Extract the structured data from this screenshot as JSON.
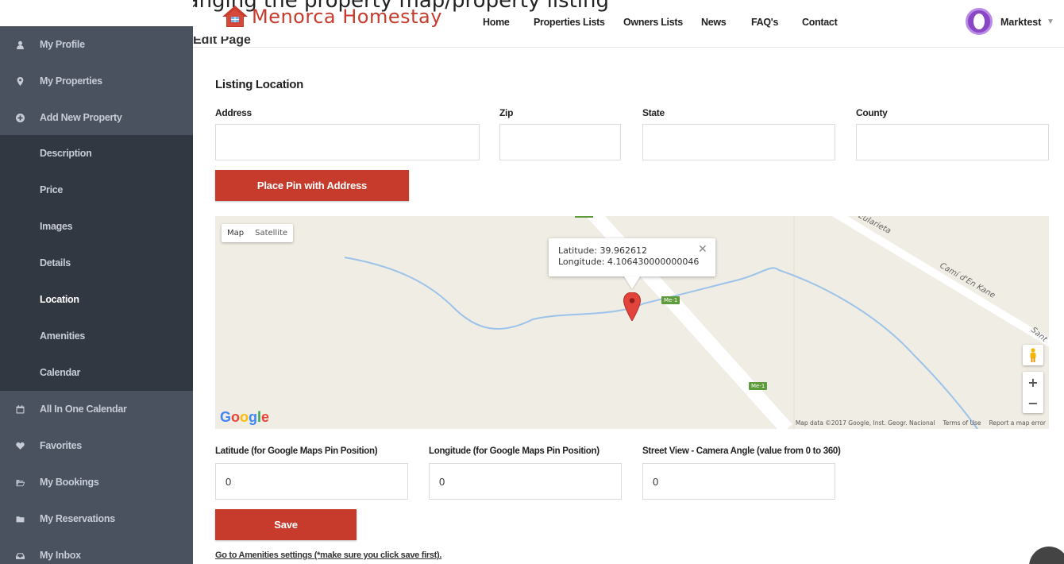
{
  "top_caption": "Changing the property map/property listing",
  "header": {
    "logo_text": "Menorca Homestay",
    "nav": [
      "Home",
      "Properties Lists",
      "Owners Lists",
      "News",
      "FAQ's",
      "Contact"
    ],
    "user_name": "Marktest"
  },
  "page_title": "Edit Page",
  "sidebar": {
    "items": [
      {
        "label": "My Profile",
        "icon": "user-icon"
      },
      {
        "label": "My Properties",
        "icon": "map-marker-icon"
      },
      {
        "label": "Add New Property",
        "icon": "plus-circle-icon"
      }
    ],
    "sub_items": [
      "Description",
      "Price",
      "Images",
      "Details",
      "Location",
      "Amenities",
      "Calendar"
    ],
    "active_sub_item": "Location",
    "bottom_items": [
      {
        "label": "All In One Calendar",
        "icon": "calendar-icon"
      },
      {
        "label": "Favorites",
        "icon": "heart-icon"
      },
      {
        "label": "My Bookings",
        "icon": "folder-open-icon"
      },
      {
        "label": "My Reservations",
        "icon": "folder-icon"
      },
      {
        "label": "My Inbox",
        "icon": "inbox-icon"
      }
    ]
  },
  "form": {
    "section_title": "Listing Location",
    "address_label": "Address",
    "zip_label": "Zip",
    "state_label": "State",
    "county_label": "County",
    "place_pin_button": "Place Pin with Address",
    "latitude_label": "Latitude (for Google Maps Pin Position)",
    "longitude_label": "Longitude (for Google Maps Pin Position)",
    "camera_label": "Street View - Camera Angle (value from 0 to 360)",
    "latitude_value": "0",
    "longitude_value": "0",
    "camera_value": "0",
    "save_button": "Save",
    "goto_link": "Go to Amenities settings (*make sure you click save first)."
  },
  "map": {
    "type_map": "Map",
    "type_satellite": "Satellite",
    "info_latitude": "Latitude: 39.962612",
    "info_longitude": "Longitude: 4.106430000000046",
    "road_label_1": "Me-1",
    "road_label_2": "Me-1",
    "street_1": "Eularieta",
    "street_2": "Camí d'En Kane",
    "street_3": "Sant",
    "google_logo": "Google",
    "footer_data": "Map data ©2017 Google, Inst. Geogr. Nacional",
    "footer_terms": "Terms of Use",
    "footer_report": "Report a map error",
    "zoom_in": "+",
    "zoom_out": "−"
  },
  "colors": {
    "accent_red": "#c73b2c",
    "sidebar_bg": "#4a5260",
    "sidebar_sub_bg": "#323842",
    "river": "#9cc3ea",
    "road": "#ffffff"
  }
}
